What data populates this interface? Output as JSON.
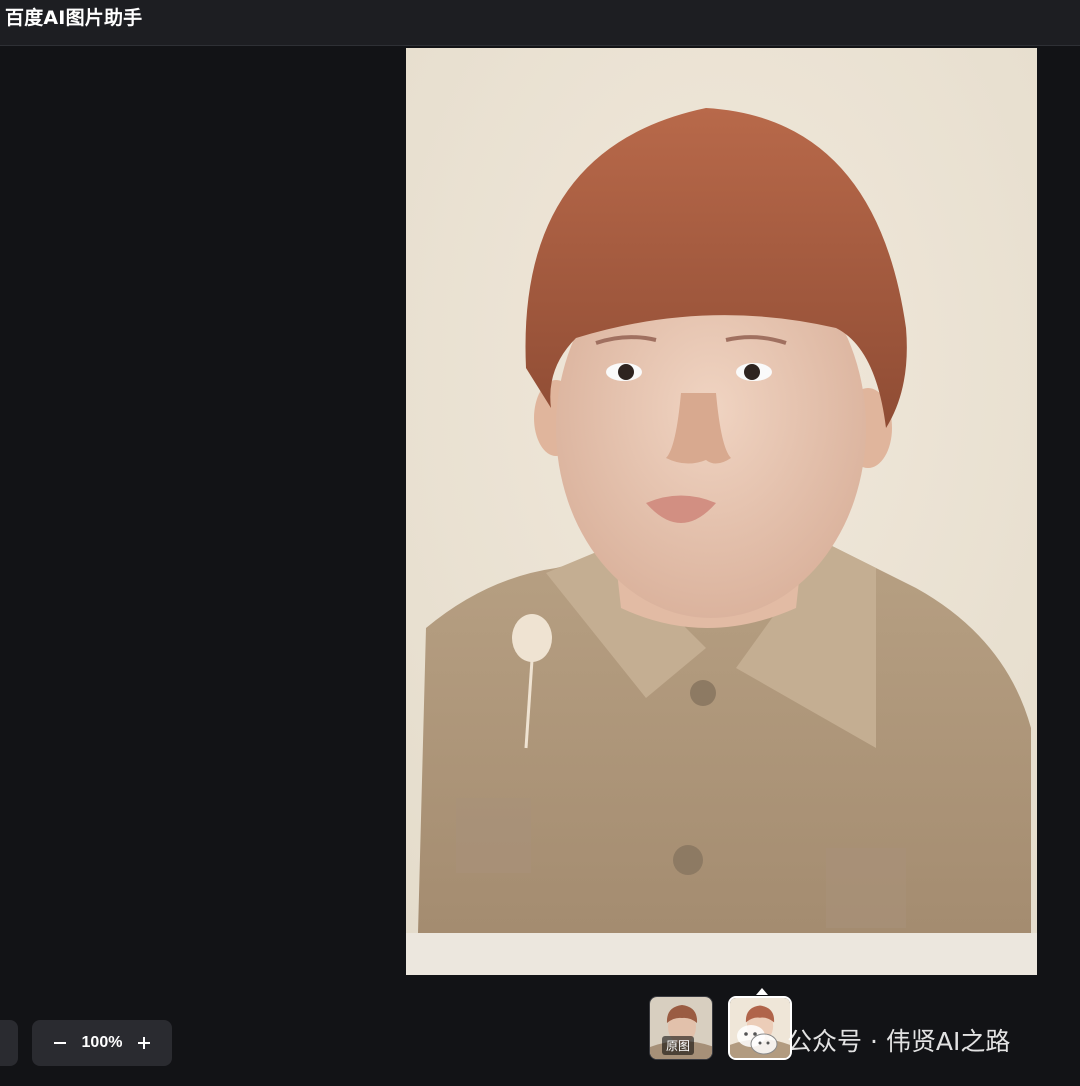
{
  "app": {
    "title": "百度AI图片助手"
  },
  "viewer": {
    "photo_alt": "restored colorized childhood portrait photo",
    "zoom_value": "100%",
    "zoom_out_icon": "minus-icon",
    "zoom_in_icon": "plus-icon"
  },
  "thumbnails": [
    {
      "label": "原图",
      "selected": false
    },
    {
      "label": "",
      "selected": true
    }
  ],
  "watermark": {
    "icon": "wechat-icon",
    "text": "公众号 · 伟贤AI之路"
  },
  "colors": {
    "background": "#121316",
    "titlebar": "#1d1e22",
    "control_bg": "#2a2b30",
    "photo_paper": "#ece7d8"
  }
}
